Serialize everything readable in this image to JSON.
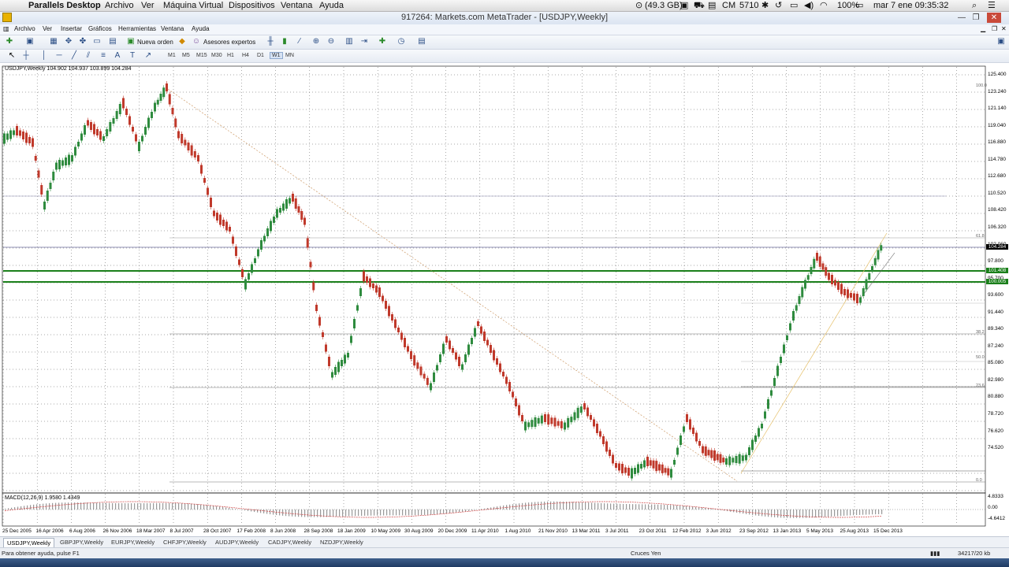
{
  "mac_menu": {
    "app": "Parallels Desktop",
    "items": [
      "Archivo",
      "Ver",
      "Máquina Virtual",
      "Dispositivos",
      "Ventana",
      "Ayuda"
    ],
    "status": {
      "memory": "(49.3 GB)",
      "user": "CM",
      "num": "5710",
      "battery": "100%",
      "datetime": "mar 7 ene  09:35:32"
    }
  },
  "window": {
    "title": "917264: Markets.com MetaTrader - [USDJPY,Weekly]"
  },
  "app_menu": [
    "Archivo",
    "Ver",
    "Insertar",
    "Gráficos",
    "Herramientas",
    "Ventana",
    "Ayuda"
  ],
  "toolbar": {
    "new_order": "Nueva orden",
    "experts": "Asesores expertos"
  },
  "timeframes": [
    "M1",
    "M5",
    "M15",
    "M30",
    "H1",
    "H4",
    "D1",
    "W1",
    "MN"
  ],
  "chart": {
    "info": "USDJPY,Weekly  104.902 104.937 103.899 104.284",
    "macd_info": "MACD(12,26,9) 1.9580 1.4349",
    "y_labels": [
      "125.400",
      "123.240",
      "121.140",
      "119.040",
      "116.880",
      "114.780",
      "112.680",
      "110.520",
      "108.420",
      "106.320",
      "104.284",
      "102.060",
      "101.408",
      "100.005",
      "97.800",
      "95.700",
      "93.600",
      "91.440",
      "89.340",
      "87.240",
      "85.080",
      "82.980",
      "80.880",
      "78.720",
      "76.620",
      "74.520"
    ],
    "macd_labels": [
      "4.8333",
      "0.00",
      "-4.6412"
    ],
    "x_labels": [
      "25 Dec 2005",
      "16 Apr 2006",
      "6 Aug 2006",
      "26 Nov 2006",
      "18 Mar 2007",
      "8 Jul 2007",
      "28 Oct 2007",
      "17 Feb 2008",
      "8 Jun 2008",
      "28 Sep 2008",
      "18 Jan 2009",
      "10 May 2009",
      "30 Aug 2009",
      "20 Dec 2009",
      "11 Apr 2010",
      "1 Aug 2010",
      "21 Nov 2010",
      "13 Mar 2011",
      "3 Jul 2011",
      "23 Oct 2011",
      "12 Feb 2012",
      "3 Jun 2012",
      "23 Sep 2012",
      "13 Jan 2013",
      "5 May 2013",
      "25 Aug 2013",
      "15 Dec 2013"
    ],
    "current_price": "104.284",
    "levels": [
      {
        "label": "101.408",
        "color": "#1a7f1a"
      },
      {
        "label": "100.005",
        "color": "#1a7f1a"
      }
    ],
    "fib_labels": [
      "100.0",
      "61.8",
      "50.0",
      "38.2",
      "23.6",
      "0.0"
    ]
  },
  "tabs": [
    "USDJPY,Weekly",
    "GBPJPY,Weekly",
    "EURJPY,Weekly",
    "CHFJPY,Weekly",
    "AUDJPY,Weekly",
    "CADJPY,Weekly",
    "NZDJPY,Weekly"
  ],
  "status_bar": {
    "help": "Para obtener ayuda, pulse F1",
    "profile": "Cruces Yen",
    "traffic": "34217/20 kb"
  }
}
